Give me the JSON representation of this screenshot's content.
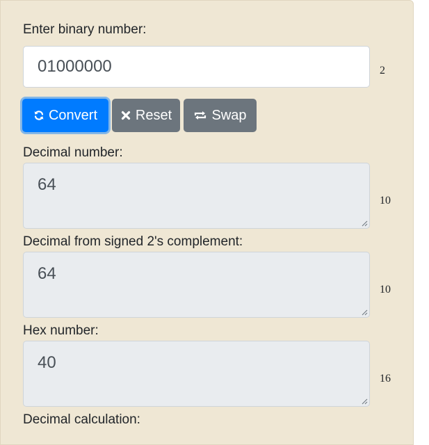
{
  "binary_input": {
    "label": "Enter binary number:",
    "value": "01000000",
    "base": "2"
  },
  "buttons": {
    "convert": "Convert",
    "reset": "Reset",
    "swap": "Swap"
  },
  "outputs": [
    {
      "label": "Decimal number:",
      "value": "64",
      "base": "10"
    },
    {
      "label": "Decimal from signed 2's complement:",
      "value": "64",
      "base": "10"
    },
    {
      "label": "Hex number:",
      "value": "40",
      "base": "16"
    }
  ],
  "next_section": {
    "label": "Decimal calculation:"
  },
  "icons": {
    "convert": "refresh-icon",
    "reset": "close-icon",
    "swap": "swap-icon"
  },
  "colors": {
    "panel_bg": "#efe7d4",
    "primary": "#007bff",
    "secondary": "#6c757d",
    "readonly_bg": "#e9ecef"
  }
}
